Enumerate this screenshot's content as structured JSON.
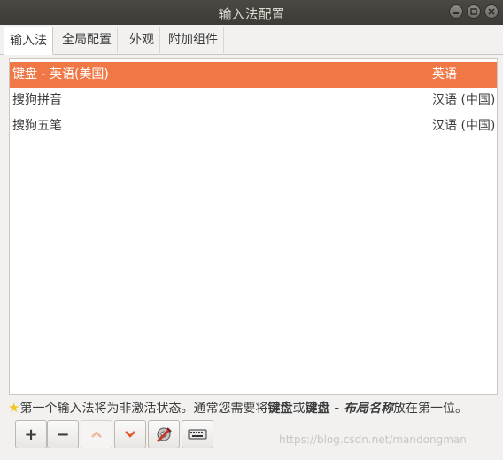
{
  "window": {
    "title": "输入法配置"
  },
  "tabs": [
    {
      "label": "输入法",
      "active": true
    },
    {
      "label": "全局配置",
      "active": false
    },
    {
      "label": "外观",
      "active": false
    },
    {
      "label": "附加组件",
      "active": false
    }
  ],
  "input_methods": [
    {
      "name": "键盘 - 英语(美国)",
      "language": "英语",
      "selected": true
    },
    {
      "name": "搜狗拼音",
      "language": "汉语 (中国)",
      "selected": false
    },
    {
      "name": "搜狗五笔",
      "language": "汉语 (中国)",
      "selected": false
    }
  ],
  "hint": {
    "part1": "第一个输入法将为非激活状态。通常您需要将",
    "bold1": "键盘",
    "part2": "或",
    "bold2a": "键盘 - ",
    "bold2b": "布局名称",
    "part3": "放在第一位。"
  },
  "toolbar": {
    "add": "+",
    "remove": "−",
    "up_icon": "chevron-up-icon",
    "down_icon": "chevron-down-icon",
    "configure_icon": "configure-icon",
    "keyboard_icon": "keyboard-icon"
  },
  "watermark": "https://blog.csdn.net/mandongman",
  "colors": {
    "selection": "#f07746",
    "titlebar": "#3c3b37",
    "arrow": "#e2572a"
  }
}
